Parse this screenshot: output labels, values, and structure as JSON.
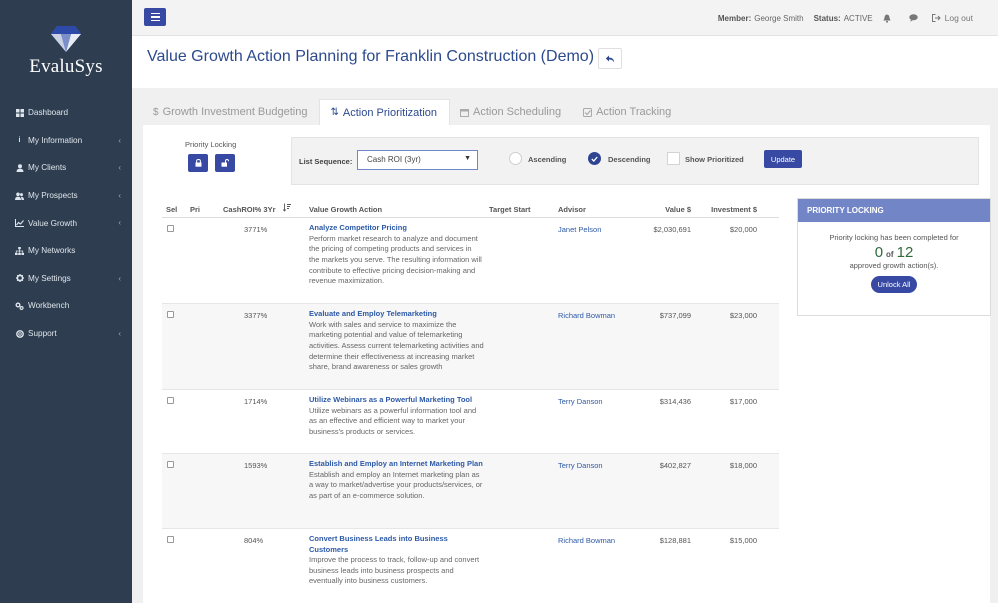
{
  "sidebar": {
    "logo_text": "EvaluSys",
    "items": [
      {
        "label": "Dashboard",
        "icon": "dashboard-icon",
        "chevron": false
      },
      {
        "label": "My Information",
        "icon": "info-icon",
        "chevron": true
      },
      {
        "label": "My Clients",
        "icon": "user-icon",
        "chevron": true
      },
      {
        "label": "My Prospects",
        "icon": "users-icon",
        "chevron": true
      },
      {
        "label": "Value Growth",
        "icon": "chart-line-icon",
        "chevron": true
      },
      {
        "label": "My Networks",
        "icon": "sitemap-icon",
        "chevron": false
      },
      {
        "label": "My Settings",
        "icon": "gear-icon",
        "chevron": true
      },
      {
        "label": "Workbench",
        "icon": "cogs-icon",
        "chevron": false
      },
      {
        "label": "Support",
        "icon": "support-icon",
        "chevron": true
      }
    ]
  },
  "topbar": {
    "member_label": "Member:",
    "member_name": "George Smith",
    "status_label": "Status:",
    "status_value": "ACTIVE",
    "logout_label": "Log out"
  },
  "header": {
    "title": "Value Growth Action Planning for Franklin Construction (Demo)"
  },
  "tabs": [
    {
      "label": "Growth Investment Budgeting",
      "icon": "dollar-icon",
      "active": false
    },
    {
      "label": "Action Prioritization",
      "icon": "sort-icon",
      "active": true
    },
    {
      "label": "Action Scheduling",
      "icon": "calendar-icon",
      "active": false
    },
    {
      "label": "Action Tracking",
      "icon": "check-square-icon",
      "active": false
    }
  ],
  "priority_locking": {
    "label": "Priority Locking"
  },
  "sequence": {
    "label": "List Sequence:",
    "selected": "Cash ROI (3yr)",
    "ascending_label": "Ascending",
    "descending_label": "Descending",
    "show_prioritized_label": "Show Prioritized",
    "update_label": "Update",
    "order": "descending"
  },
  "table": {
    "headers": {
      "sel": "Sel",
      "pri": "Pri",
      "roi": "CashROI% 3Yr",
      "action": "Value Growth Action",
      "target": "Target Start",
      "advisor": "Advisor",
      "value": "Value $",
      "investment": "Investment $"
    },
    "rows": [
      {
        "roi": "3771%",
        "title": "Analyze Competitor Pricing",
        "desc": "Perform market research to analyze and document the pricing of competing products and services in the markets you serve. The resulting information will contribute to effective pricing decision-making and revenue maximization.",
        "advisor": "Janet Pelson",
        "value": "$2,030,691",
        "investment": "$20,000"
      },
      {
        "roi": "3377%",
        "title": "Evaluate and Employ Telemarketing",
        "desc": "Work with sales and service to maximize the marketing potential and value of telemarketing activities. Assess current telemarketing activities and determine their effectiveness at increasing market share, brand awareness or sales growth",
        "advisor": "Richard Bowman",
        "value": "$737,099",
        "investment": "$23,000"
      },
      {
        "roi": "1714%",
        "title": "Utilize Webinars as a Powerful Marketing Tool",
        "desc": "Utilize webinars as a powerful information tool and as an effective and efficient way to market your business's products or services.",
        "advisor": "Terry Danson",
        "value": "$314,436",
        "investment": "$17,000"
      },
      {
        "roi": "1593%",
        "title": "Establish and Employ an Internet Marketing Plan",
        "desc": "Establish and employ an Internet marketing plan as a way to market/advertise your products/services, or as part of an e-commerce solution.",
        "advisor": "Terry Danson",
        "value": "$402,827",
        "investment": "$18,000"
      },
      {
        "roi": "804%",
        "title": "Convert Business Leads into Business Customers",
        "desc": "Improve the process to track, follow-up and convert business leads into business prospects and eventually into business customers.",
        "advisor": "Richard Bowman",
        "value": "$128,881",
        "investment": "$15,000"
      }
    ]
  },
  "locking_card": {
    "heading": "PRIORITY LOCKING",
    "text1": "Priority locking has been completed for",
    "count_done": "0",
    "of_label": "of",
    "count_total": "12",
    "text2": "approved growth action(s).",
    "unlock_label": "Unlock All"
  },
  "colors": {
    "sidebar_bg": "#2e3e50",
    "accent": "#3749a3",
    "title_blue": "#2d4a8e",
    "link_blue": "#2d5aa7",
    "card_header": "#7286c7",
    "count_green": "#2f6b3a"
  }
}
